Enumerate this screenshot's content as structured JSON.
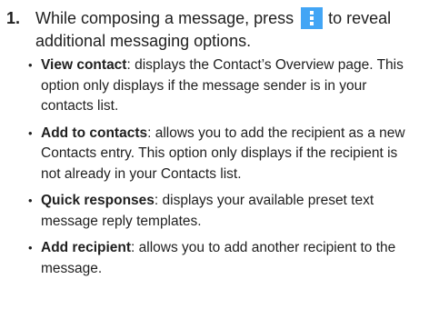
{
  "step": {
    "number": "1.",
    "before_icon": "While composing a message, press",
    "icon": "vertical-ellipsis-menu-icon",
    "after_icon": "to reveal additional messaging options."
  },
  "options": [
    {
      "term": "View contact",
      "description": ": displays the Contact’s Overview page. This option only displays if the message sender is in your contacts list."
    },
    {
      "term": "Add to contacts",
      "description": ": allows you to add the recipient as a new Contacts entry. This option only displays if the recipient is not already in your Contacts list."
    },
    {
      "term": "Quick responses",
      "description": ": displays your available preset text message reply templates."
    },
    {
      "term": "Add recipient",
      "description": ": allows you to add another recipient to the message."
    }
  ],
  "colors": {
    "icon_background": "#42a5f5",
    "link_text": "#3d8fcf",
    "body_text": "#1f1f1f"
  }
}
